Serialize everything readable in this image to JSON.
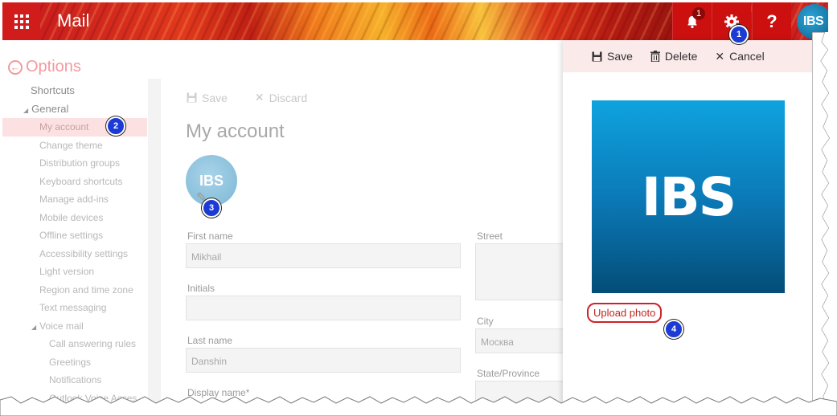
{
  "app": {
    "title": "Mail",
    "notification_count": "1",
    "help_label": "?",
    "avatar_initials": "IBS"
  },
  "nav": {
    "back_label": "Options",
    "items": [
      {
        "label": "Shortcuts",
        "level": 1
      },
      {
        "label": "General",
        "level": 1,
        "expanded": true
      },
      {
        "label": "My account",
        "level": 2,
        "selected": true
      },
      {
        "label": "Change theme",
        "level": 2
      },
      {
        "label": "Distribution groups",
        "level": 2
      },
      {
        "label": "Keyboard shortcuts",
        "level": 2
      },
      {
        "label": "Manage add-ins",
        "level": 2
      },
      {
        "label": "Mobile devices",
        "level": 2
      },
      {
        "label": "Offline settings",
        "level": 2
      },
      {
        "label": "Accessibility settings",
        "level": 2
      },
      {
        "label": "Light version",
        "level": 2
      },
      {
        "label": "Region and time zone",
        "level": 2
      },
      {
        "label": "Text messaging",
        "level": 2
      },
      {
        "label": "Voice mail",
        "level": 2,
        "expanded": true
      },
      {
        "label": "Call answering rules",
        "level": 3
      },
      {
        "label": "Greetings",
        "level": 3
      },
      {
        "label": "Notifications",
        "level": 3
      },
      {
        "label": "Outlook Voice Acces",
        "level": 3
      }
    ]
  },
  "main": {
    "save_label": "Save",
    "discard_label": "Discard",
    "title": "My account",
    "avatar_initials": "IBS",
    "fields": {
      "first_name": {
        "label": "First name",
        "value": "Mikhail"
      },
      "initials": {
        "label": "Initials",
        "value": ""
      },
      "last_name": {
        "label": "Last name",
        "value": "Danshin"
      },
      "display_name": {
        "label": "Display name",
        "required_mark": "*"
      },
      "street": {
        "label": "Street",
        "value": ""
      },
      "city": {
        "label": "City",
        "value": "Москва"
      },
      "state": {
        "label": "State/Province",
        "value": ""
      }
    }
  },
  "panel": {
    "save_label": "Save",
    "delete_label": "Delete",
    "cancel_label": "Cancel",
    "logo_text": "IBS",
    "upload_label": "Upload photo"
  },
  "callouts": [
    "1",
    "2",
    "3",
    "4"
  ],
  "colors": {
    "accent": "#cc1010",
    "callout": "#1c3bd4",
    "selection": "#fbe1e1"
  }
}
